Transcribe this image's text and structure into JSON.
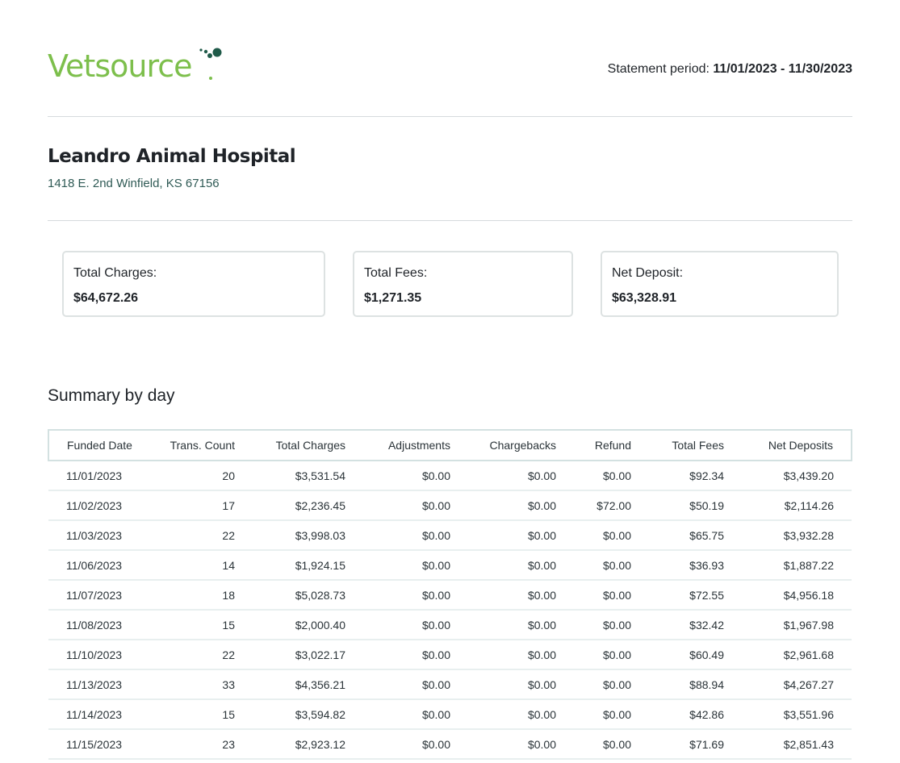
{
  "brand": {
    "name": "Vetsource",
    "primary_color": "#7dbf4c",
    "dot_color": "#1f5a49"
  },
  "statement": {
    "period_label": "Statement period:",
    "period_value": "11/01/2023 - 11/30/2023"
  },
  "clinic": {
    "name": "Leandro Animal Hospital",
    "address": "1418 E. 2nd Winfield, KS 67156"
  },
  "summary": {
    "total_charges_label": "Total Charges:",
    "total_charges": "$64,672.26",
    "total_fees_label": "Total Fees:",
    "total_fees": "$1,271.35",
    "net_deposit_label": "Net Deposit:",
    "net_deposit": "$63,328.91"
  },
  "daily": {
    "title": "Summary by day",
    "columns": [
      "Funded Date",
      "Trans. Count",
      "Total Charges",
      "Adjustments",
      "Chargebacks",
      "Refund",
      "Total Fees",
      "Net Deposits"
    ],
    "rows": [
      [
        "11/01/2023",
        "20",
        "$3,531.54",
        "$0.00",
        "$0.00",
        "$0.00",
        "$92.34",
        "$3,439.20"
      ],
      [
        "11/02/2023",
        "17",
        "$2,236.45",
        "$0.00",
        "$0.00",
        "$72.00",
        "$50.19",
        "$2,114.26"
      ],
      [
        "11/03/2023",
        "22",
        "$3,998.03",
        "$0.00",
        "$0.00",
        "$0.00",
        "$65.75",
        "$3,932.28"
      ],
      [
        "11/06/2023",
        "14",
        "$1,924.15",
        "$0.00",
        "$0.00",
        "$0.00",
        "$36.93",
        "$1,887.22"
      ],
      [
        "11/07/2023",
        "18",
        "$5,028.73",
        "$0.00",
        "$0.00",
        "$0.00",
        "$72.55",
        "$4,956.18"
      ],
      [
        "11/08/2023",
        "15",
        "$2,000.40",
        "$0.00",
        "$0.00",
        "$0.00",
        "$32.42",
        "$1,967.98"
      ],
      [
        "11/10/2023",
        "22",
        "$3,022.17",
        "$0.00",
        "$0.00",
        "$0.00",
        "$60.49",
        "$2,961.68"
      ],
      [
        "11/13/2023",
        "33",
        "$4,356.21",
        "$0.00",
        "$0.00",
        "$0.00",
        "$88.94",
        "$4,267.27"
      ],
      [
        "11/14/2023",
        "15",
        "$3,594.82",
        "$0.00",
        "$0.00",
        "$0.00",
        "$42.86",
        "$3,551.96"
      ],
      [
        "11/15/2023",
        "23",
        "$2,923.12",
        "$0.00",
        "$0.00",
        "$0.00",
        "$71.69",
        "$2,851.43"
      ]
    ]
  }
}
